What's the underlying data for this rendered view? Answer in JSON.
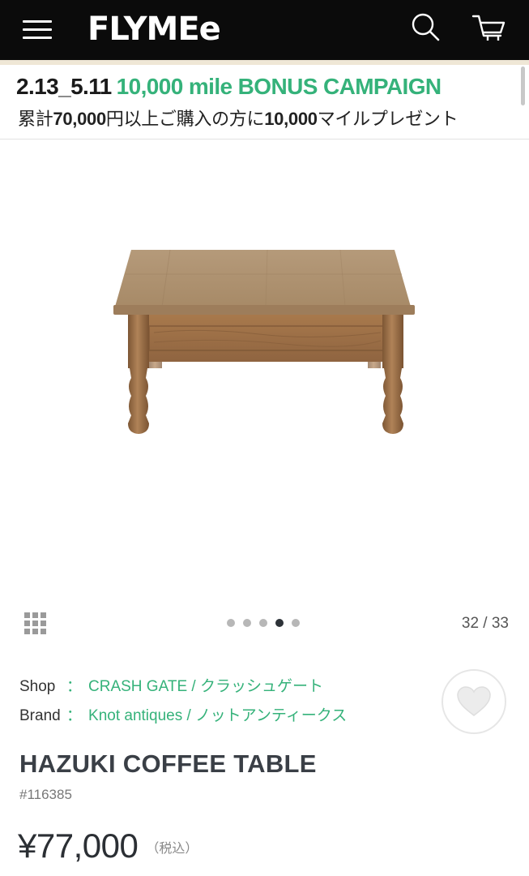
{
  "header": {
    "logo": "FLYMEe",
    "icons": {
      "menu": "hamburger-menu-icon",
      "search": "search-icon",
      "cart": "cart-icon"
    },
    "background": "#0b0b0b"
  },
  "campaign": {
    "dates": "2.13_5.11",
    "title": "10,000 mile BONUS CAMPAIGN",
    "desc_part1": "累計",
    "desc_amount": "70,000",
    "desc_part2": "円以上ご購入の方に",
    "desc_miles": "10,000",
    "desc_part3": "マイルプレゼント",
    "accent": "#35b27a"
  },
  "gallery": {
    "counter": "32 / 33",
    "dot_count": 5,
    "active_dot": 4,
    "image_subject": "wooden coffee table with turned legs"
  },
  "product": {
    "shop_label": "Shop",
    "shop_sep": "：",
    "shop_value": "CRASH GATE / クラッシュゲート",
    "brand_label": "Brand",
    "brand_sep": "：",
    "brand_value": "Knot antiques / ノットアンティークス",
    "name": "HAZUKI COFFEE TABLE",
    "code": "#116385",
    "price": "¥77,000",
    "tax_note": "（税込）",
    "favorite_icon": "heart-icon"
  }
}
